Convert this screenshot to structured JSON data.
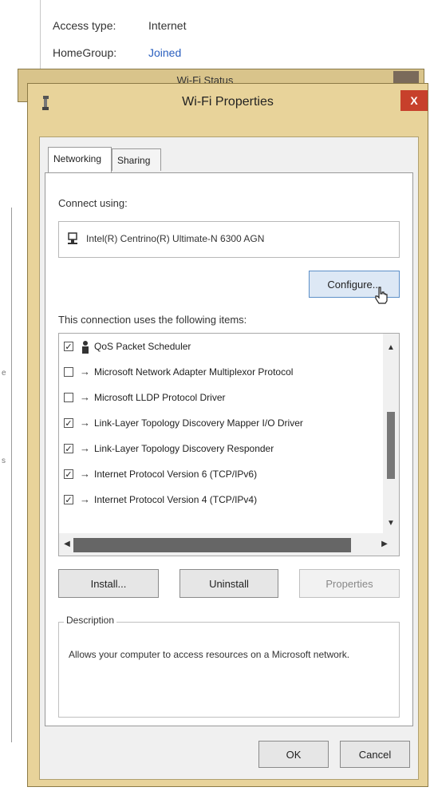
{
  "background": {
    "access_type_label": "Access type:",
    "access_type_value": "Internet",
    "homegroup_label": "HomeGroup:",
    "homegroup_value": "Joined",
    "side_marks": [
      "e",
      "s"
    ]
  },
  "status_dialog": {
    "title": "Wi-Fi Status"
  },
  "dialog": {
    "title": "Wi-Fi Properties",
    "close_label": "X",
    "tabs": [
      {
        "label": "Networking",
        "active": true
      },
      {
        "label": "Sharing",
        "active": false
      }
    ],
    "connect_using_label": "Connect using:",
    "adapter_name": "Intel(R) Centrino(R) Ultimate-N 6300 AGN",
    "configure_label": "Configure...",
    "items_label": "This connection uses the following items:",
    "items": [
      {
        "checked": true,
        "icon": "scheduler-icon",
        "label": "QoS Packet Scheduler"
      },
      {
        "checked": false,
        "icon": "protocol-icon",
        "label": "Microsoft Network Adapter Multiplexor Protocol"
      },
      {
        "checked": false,
        "icon": "protocol-icon",
        "label": "Microsoft LLDP Protocol Driver"
      },
      {
        "checked": true,
        "icon": "protocol-icon",
        "label": "Link-Layer Topology Discovery Mapper I/O Driver"
      },
      {
        "checked": true,
        "icon": "protocol-icon",
        "label": "Link-Layer Topology Discovery Responder"
      },
      {
        "checked": true,
        "icon": "protocol-icon",
        "label": "Internet Protocol Version 6 (TCP/IPv6)"
      },
      {
        "checked": true,
        "icon": "protocol-icon",
        "label": "Internet Protocol Version 4 (TCP/IPv4)"
      }
    ],
    "install_label": "Install...",
    "uninstall_label": "Uninstall",
    "properties_label": "Properties",
    "description_title": "Description",
    "description_text": "Allows your computer to access resources on a Microsoft network.",
    "ok_label": "OK",
    "cancel_label": "Cancel"
  },
  "colors": {
    "frame": "#e8d39a",
    "close": "#c7402b",
    "link": "#2a5fbf"
  }
}
